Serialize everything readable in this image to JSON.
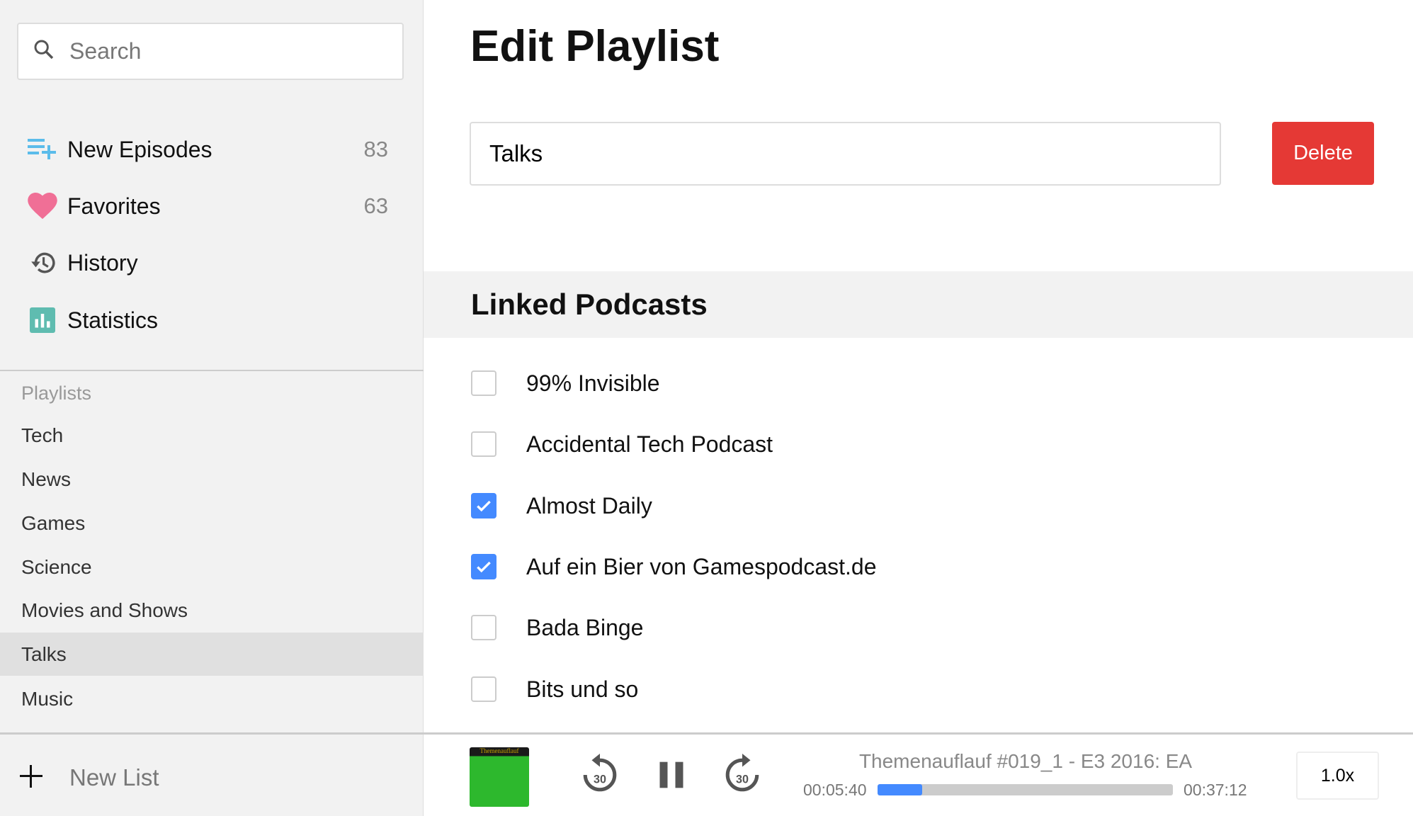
{
  "sidebar": {
    "search": {
      "placeholder": "Search",
      "value": ""
    },
    "nav": [
      {
        "label": "New Episodes",
        "count": "83",
        "icon": "playlist-add-icon",
        "color": "#5bbcea"
      },
      {
        "label": "Favorites",
        "count": "63",
        "icon": "heart-icon",
        "color": "#f06f96"
      },
      {
        "label": "History",
        "icon": "history-icon"
      },
      {
        "label": "Statistics",
        "icon": "bar-chart-icon",
        "color": "#5fbcb0"
      }
    ],
    "playlists_heading": "Playlists",
    "playlists": [
      "Tech",
      "News",
      "Games",
      "Science",
      "Movies and Shows",
      "Talks",
      "Music"
    ],
    "selected_playlist": "Talks",
    "new_list": "New List"
  },
  "main": {
    "title": "Edit Playlist",
    "name_value": "Talks",
    "delete_label": "Delete",
    "delete_color": "#e53935",
    "linked_heading": "Linked Podcasts",
    "podcasts": [
      {
        "name": "99% Invisible",
        "checked": false
      },
      {
        "name": "Accidental Tech Podcast",
        "checked": false
      },
      {
        "name": "Almost Daily",
        "checked": true
      },
      {
        "name": "Auf ein Bier von Gamespodcast.de",
        "checked": true
      },
      {
        "name": "Bada Binge",
        "checked": false
      },
      {
        "name": "Bits und so",
        "checked": false
      }
    ]
  },
  "player": {
    "artwork_text": "Themenauflauf",
    "episode_title": "Themenauflauf #019_1 - E3 2016: EA",
    "elapsed": "00:05:40",
    "duration": "00:37:12",
    "progress_percent": 15.2,
    "skip_seconds": "30",
    "speed": "1.0x",
    "accent": "#448aff"
  }
}
